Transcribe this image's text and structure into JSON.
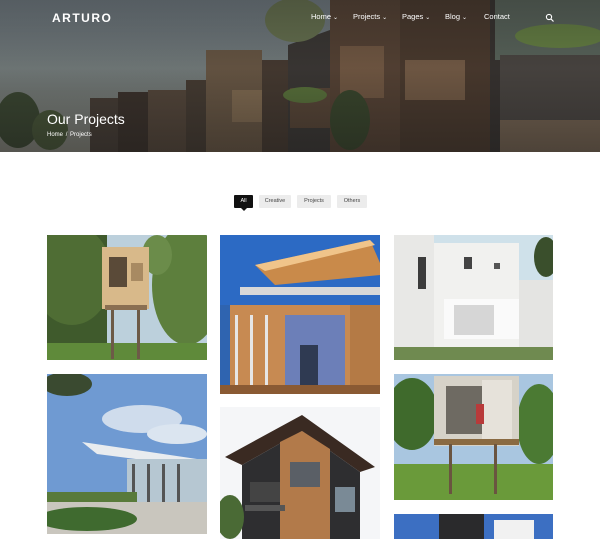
{
  "header": {
    "logo_text": "ARTURO",
    "logo_mark": "Λ",
    "nav": [
      {
        "label": "Home",
        "has_dropdown": true
      },
      {
        "label": "Projects",
        "has_dropdown": true
      },
      {
        "label": "Pages",
        "has_dropdown": true
      },
      {
        "label": "Blog",
        "has_dropdown": true
      },
      {
        "label": "Contact",
        "has_dropdown": false
      }
    ],
    "search_icon": "search-icon",
    "dropdown_glyph": "⌄"
  },
  "hero": {
    "title": "Our Projects",
    "breadcrumb": {
      "home": "Home",
      "separator": "/",
      "current": "Projects"
    }
  },
  "filters": [
    {
      "label": "All",
      "active": true
    },
    {
      "label": "Creative",
      "active": false
    },
    {
      "label": "Projects",
      "active": false
    },
    {
      "label": "Others",
      "active": false
    }
  ],
  "colors": {
    "active_filter_bg": "#111111",
    "filter_bg": "#ececec",
    "text_white": "#ffffff"
  }
}
